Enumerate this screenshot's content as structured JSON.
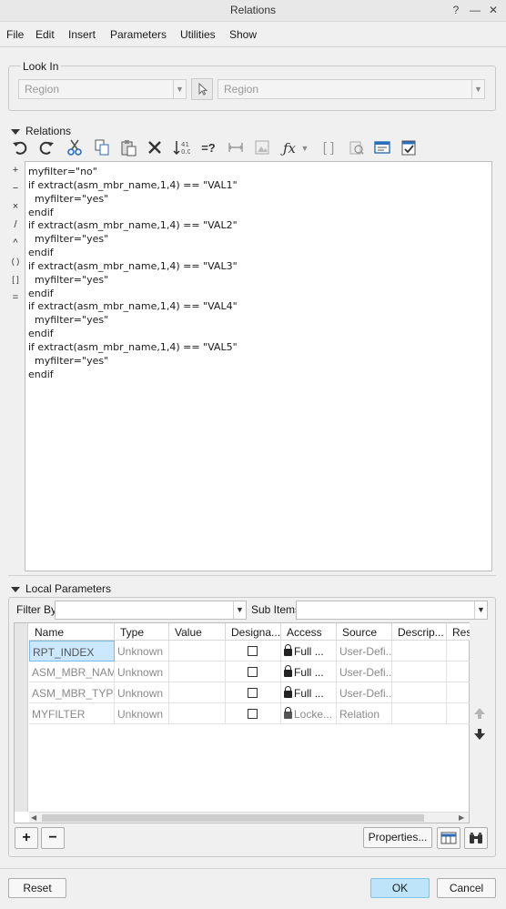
{
  "window": {
    "title": "Relations",
    "help": "?",
    "minimize": "—",
    "maximize": "☐",
    "close": "✕"
  },
  "menu": [
    "File",
    "Edit",
    "Insert",
    "Parameters",
    "Utilities",
    "Show"
  ],
  "look_in": {
    "label": "Look In",
    "type_value": "Region",
    "item_value": "Region"
  },
  "relations": {
    "label": "Relations",
    "toolbar_icons": [
      "undo-icon",
      "redo-icon",
      "cut-icon",
      "copy-icon",
      "paste-icon",
      "delete-icon",
      "sort-relations-icon",
      "evaluate-icon",
      "dimension-icon",
      "insert-image-icon",
      "function-icon",
      "dropdown-icon",
      "brackets-icon",
      "verify-icon",
      "unit-sensitive-icon",
      "checklist-icon"
    ],
    "operators": [
      "+",
      "−",
      "×",
      "/",
      "^",
      "( )",
      "[ ]",
      "="
    ],
    "lines": [
      "myfilter=\"no\"",
      "if extract(asm_mbr_name,1,4) == \"VAL1\"",
      "  myfilter=\"yes\"",
      "endif",
      "if extract(asm_mbr_name,1,4) == \"VAL2\"",
      "  myfilter=\"yes\"",
      "endif",
      "if extract(asm_mbr_name,1,4) == \"VAL3\"",
      "  myfilter=\"yes\"",
      "endif",
      "if extract(asm_mbr_name,1,4) == \"VAL4\"",
      "  myfilter=\"yes\"",
      "endif",
      "if extract(asm_mbr_name,1,4) == \"VAL5\"",
      "  myfilter=\"yes\"",
      "endif"
    ]
  },
  "local_params": {
    "label": "Local Parameters",
    "filter_by_label": "Filter By",
    "filter_by_value": "",
    "sub_items_label": "Sub Items",
    "sub_items_value": "",
    "columns": [
      "Name",
      "Type",
      "Value",
      "Designa...",
      "Access",
      "Source",
      "Descrip...",
      "Res"
    ],
    "rows": [
      {
        "name": "RPT_INDEX",
        "type": "Unknown",
        "value": "",
        "access": "Full",
        "source": "User-Defi...",
        "selected": true
      },
      {
        "name": "ASM_MBR_NAME",
        "type": "Unknown",
        "value": "",
        "access": "Full",
        "source": "User-Defi...",
        "selected": false
      },
      {
        "name": "ASM_MBR_TYPE",
        "type": "Unknown",
        "value": "",
        "access": "Full",
        "source": "User-Defi...",
        "selected": false
      },
      {
        "name": "MYFILTER",
        "type": "Unknown",
        "value": "",
        "access": "Locke...",
        "source": "Relation",
        "selected": false
      }
    ],
    "more_glyph": "...",
    "add_label": "+",
    "remove_label": "−",
    "properties_label": "Properties..."
  },
  "footer": {
    "reset": "Reset",
    "ok": "OK",
    "cancel": "Cancel"
  },
  "colors": {
    "ok_bg": "#bde4f9",
    "selected_cell": "#cce8ff",
    "window_bg": "#f0f0f0"
  }
}
